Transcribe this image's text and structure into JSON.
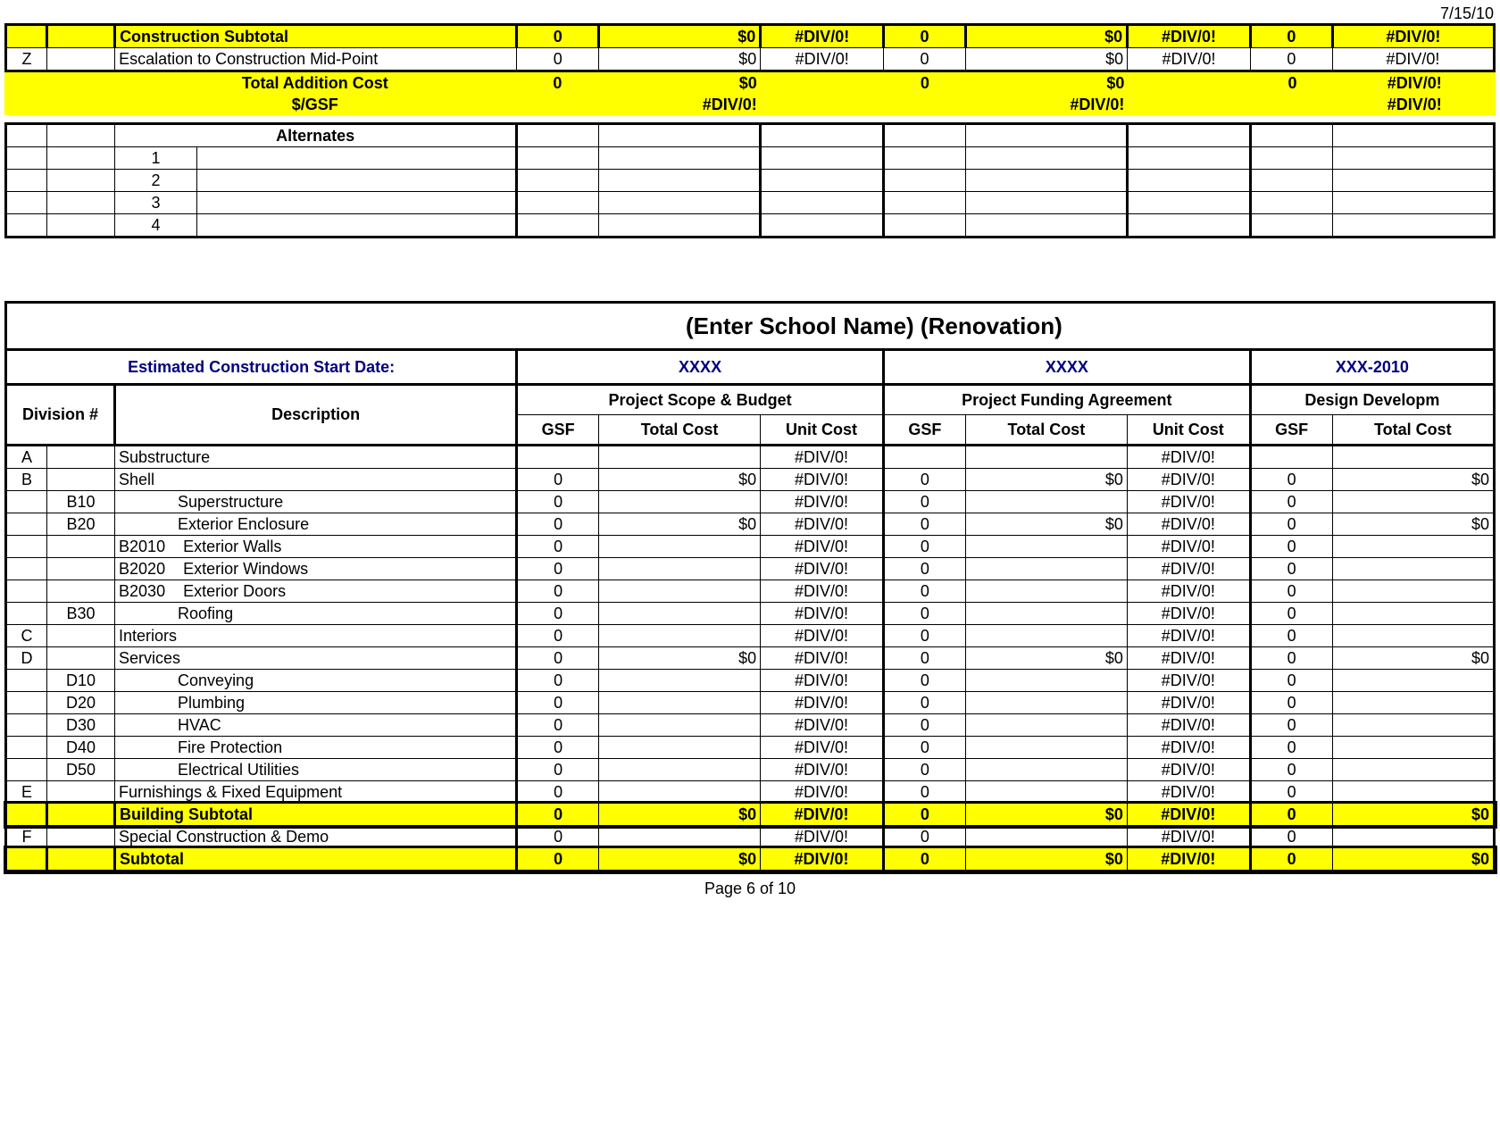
{
  "date": "7/15/10",
  "top": {
    "construction_subtotal": "Construction Subtotal",
    "escalation": "Escalation to Construction Mid-Point",
    "escalation_code": "Z",
    "total_addition": "Total Addition Cost",
    "per_gsf": "$/GSF",
    "zero": "0",
    "dollar0": "$0",
    "div0": "#DIV/0!"
  },
  "alternates": {
    "header": "Alternates",
    "rows": [
      "1",
      "2",
      "3",
      "4"
    ]
  },
  "lower": {
    "title": "(Enter School Name) (Renovation)",
    "start_date_label": "Estimated Construction Start Date:",
    "col1_date": "XXXX",
    "col2_date": "XXXX",
    "col3_date": "XXX-2010",
    "group1": "Project Scope & Budget",
    "group2": "Project Funding Agreement",
    "group3": "Design Developm",
    "division": "Division #",
    "description": "Description",
    "gsf": "GSF",
    "total_cost": "Total Cost",
    "unit_cost": "Unit Cost"
  },
  "rows": [
    {
      "a": "A",
      "b": "",
      "c": "Substructure",
      "gsf": "",
      "tc": "",
      "uc": "#DIV/0!",
      "gsf2": "",
      "tc2": "",
      "uc2": "#DIV/0!",
      "gsf3": "",
      "tc3": ""
    },
    {
      "a": "B",
      "b": "",
      "c": "Shell",
      "gsf": "0",
      "tc": "$0",
      "uc": "#DIV/0!",
      "gsf2": "0",
      "tc2": "$0",
      "uc2": "#DIV/0!",
      "gsf3": "0",
      "tc3": "$0"
    },
    {
      "a": "",
      "b": "B10",
      "c": "Superstructure",
      "ind": 2,
      "gsf": "0",
      "tc": "",
      "uc": "#DIV/0!",
      "gsf2": "0",
      "tc2": "",
      "uc2": "#DIV/0!",
      "gsf3": "0",
      "tc3": ""
    },
    {
      "a": "",
      "b": "B20",
      "c": "Exterior Enclosure",
      "ind": 2,
      "gsf": "0",
      "tc": "$0",
      "uc": "#DIV/0!",
      "gsf2": "0",
      "tc2": "$0",
      "uc2": "#DIV/0!",
      "gsf3": "0",
      "tc3": "$0"
    },
    {
      "a": "",
      "b": "",
      "c": "B2010    Exterior Walls",
      "gsf": "0",
      "tc": "",
      "uc": "#DIV/0!",
      "gsf2": "0",
      "tc2": "",
      "uc2": "#DIV/0!",
      "gsf3": "0",
      "tc3": ""
    },
    {
      "a": "",
      "b": "",
      "c": "B2020    Exterior Windows",
      "gsf": "0",
      "tc": "",
      "uc": "#DIV/0!",
      "gsf2": "0",
      "tc2": "",
      "uc2": "#DIV/0!",
      "gsf3": "0",
      "tc3": ""
    },
    {
      "a": "",
      "b": "",
      "c": "B2030    Exterior Doors",
      "gsf": "0",
      "tc": "",
      "uc": "#DIV/0!",
      "gsf2": "0",
      "tc2": "",
      "uc2": "#DIV/0!",
      "gsf3": "0",
      "tc3": ""
    },
    {
      "a": "",
      "b": "B30",
      "c": "Roofing",
      "ind": 2,
      "gsf": "0",
      "tc": "",
      "uc": "#DIV/0!",
      "gsf2": "0",
      "tc2": "",
      "uc2": "#DIV/0!",
      "gsf3": "0",
      "tc3": ""
    },
    {
      "a": "C",
      "b": "",
      "c": "Interiors",
      "gsf": "0",
      "tc": "",
      "uc": "#DIV/0!",
      "gsf2": "0",
      "tc2": "",
      "uc2": "#DIV/0!",
      "gsf3": "0",
      "tc3": ""
    },
    {
      "a": "D",
      "b": "",
      "c": "Services",
      "gsf": "0",
      "tc": "$0",
      "uc": "#DIV/0!",
      "gsf2": "0",
      "tc2": "$0",
      "uc2": "#DIV/0!",
      "gsf3": "0",
      "tc3": "$0"
    },
    {
      "a": "",
      "b": "D10",
      "c": "Conveying",
      "ind": 2,
      "gsf": "0",
      "tc": "",
      "uc": "#DIV/0!",
      "gsf2": "0",
      "tc2": "",
      "uc2": "#DIV/0!",
      "gsf3": "0",
      "tc3": ""
    },
    {
      "a": "",
      "b": "D20",
      "c": "Plumbing",
      "ind": 2,
      "gsf": "0",
      "tc": "",
      "uc": "#DIV/0!",
      "gsf2": "0",
      "tc2": "",
      "uc2": "#DIV/0!",
      "gsf3": "0",
      "tc3": ""
    },
    {
      "a": "",
      "b": "D30",
      "c": "HVAC",
      "ind": 2,
      "gsf": "0",
      "tc": "",
      "uc": "#DIV/0!",
      "gsf2": "0",
      "tc2": "",
      "uc2": "#DIV/0!",
      "gsf3": "0",
      "tc3": ""
    },
    {
      "a": "",
      "b": "D40",
      "c": "Fire Protection",
      "ind": 2,
      "gsf": "0",
      "tc": "",
      "uc": "#DIV/0!",
      "gsf2": "0",
      "tc2": "",
      "uc2": "#DIV/0!",
      "gsf3": "0",
      "tc3": ""
    },
    {
      "a": "",
      "b": "D50",
      "c": "Electrical Utilities",
      "ind": 2,
      "gsf": "0",
      "tc": "",
      "uc": "#DIV/0!",
      "gsf2": "0",
      "tc2": "",
      "uc2": "#DIV/0!",
      "gsf3": "0",
      "tc3": ""
    },
    {
      "a": "E",
      "b": "",
      "c": "Furnishings & Fixed Equipment",
      "gsf": "0",
      "tc": "",
      "uc": "#DIV/0!",
      "gsf2": "0",
      "tc2": "",
      "uc2": "#DIV/0!",
      "gsf3": "0",
      "tc3": ""
    }
  ],
  "building_subtotal": {
    "label": "Building Subtotal",
    "gsf": "0",
    "tc": "$0",
    "uc": "#DIV/0!",
    "gsf2": "0",
    "tc2": "$0",
    "uc2": "#DIV/0!",
    "gsf3": "0",
    "tc3": "$0"
  },
  "special": {
    "a": "F",
    "label": "Special Construction & Demo",
    "gsf": "0",
    "tc": "",
    "uc": "#DIV/0!",
    "gsf2": "0",
    "tc2": "",
    "uc2": "#DIV/0!",
    "gsf3": "0",
    "tc3": ""
  },
  "subtotal": {
    "label": "Subtotal",
    "gsf": "0",
    "tc": "$0",
    "uc": "#DIV/0!",
    "gsf2": "0",
    "tc2": "$0",
    "uc2": "#DIV/0!",
    "gsf3": "0",
    "tc3": "$0"
  },
  "footer": "Page 6 of 10"
}
